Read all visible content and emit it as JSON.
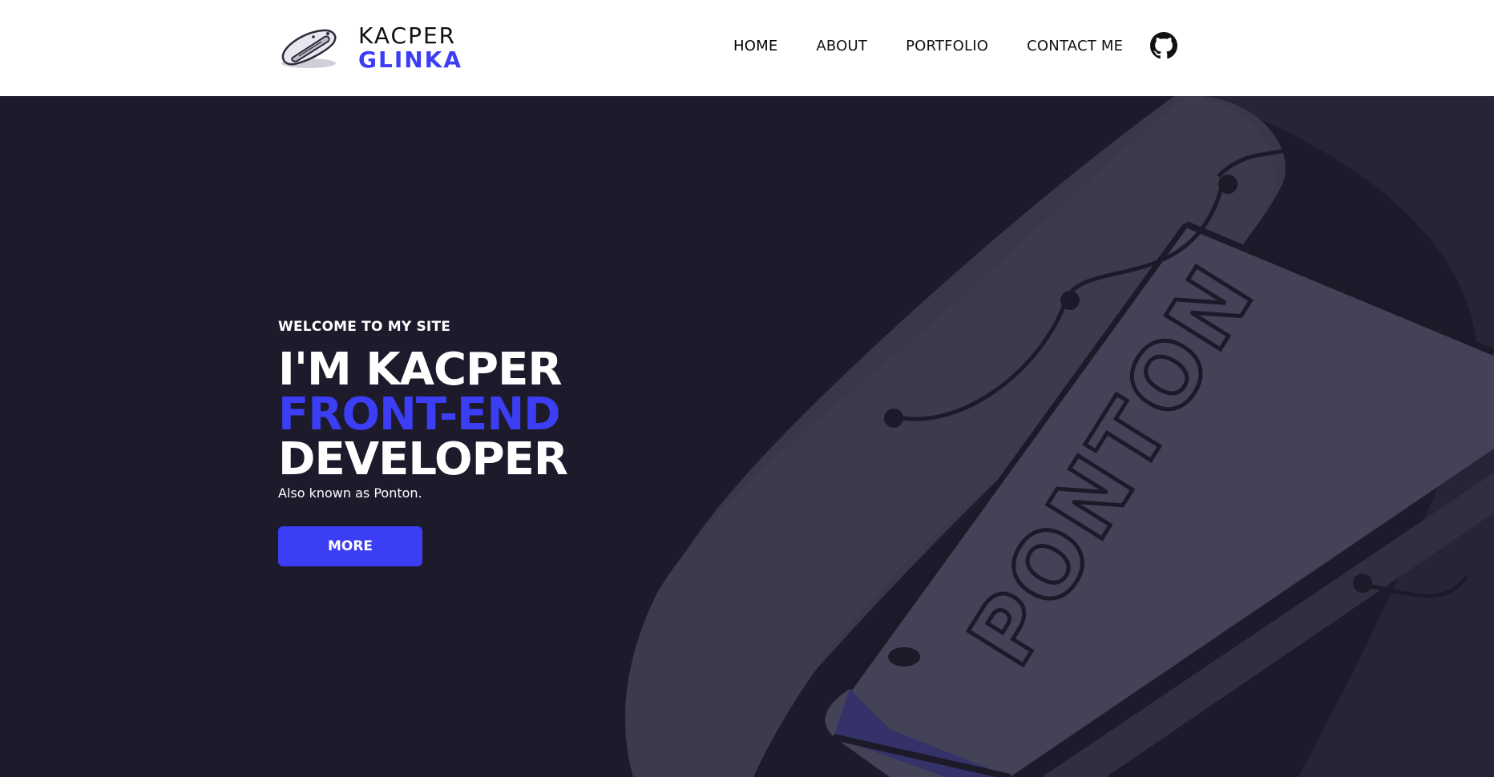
{
  "brand": {
    "first_name": "KACPER",
    "last_name": "GLINKA",
    "logo_icon": "ponton-pontoon-logo",
    "accent_color": "#3b3ef5"
  },
  "nav": {
    "items": [
      {
        "label": "HOME",
        "active": true
      },
      {
        "label": "ABOUT",
        "active": false
      },
      {
        "label": "PORTFOLIO",
        "active": false
      },
      {
        "label": "CONTACT ME",
        "active": false
      }
    ],
    "github_icon": "github-icon"
  },
  "hero": {
    "welcome": "WELCOME TO MY SITE",
    "line1": "I'M KACPER",
    "line2": "FRONT-END",
    "line3": "DEVELOPER",
    "subtitle": "Also known as Ponton.",
    "button_label": "MORE",
    "background_text": "PONTON",
    "background_color": "#1d1b2b"
  }
}
